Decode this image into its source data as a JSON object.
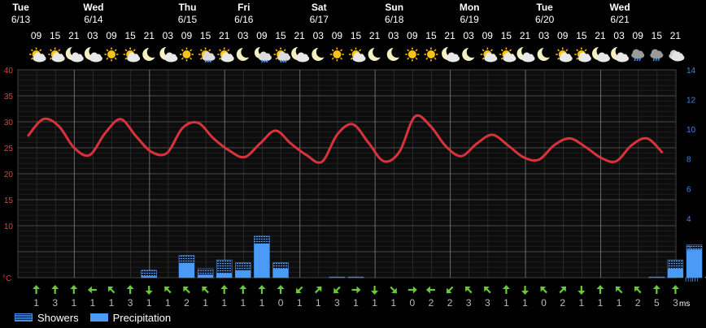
{
  "chart_data": {
    "type": "weather-forecast",
    "days": [
      {
        "name": "Tue",
        "date": "6/13"
      },
      {
        "name": "Wed",
        "date": "6/14"
      },
      {
        "name": "Thu",
        "date": "6/15"
      },
      {
        "name": "Fri",
        "date": "6/16"
      },
      {
        "name": "Sat",
        "date": "6/17"
      },
      {
        "name": "Sun",
        "date": "6/18"
      },
      {
        "name": "Mon",
        "date": "6/19"
      },
      {
        "name": "Tue",
        "date": "6/20"
      },
      {
        "name": "Wed",
        "date": "6/21"
      }
    ],
    "hours": [
      "09",
      "15",
      "21",
      "03",
      "09",
      "15",
      "21",
      "03",
      "09",
      "15",
      "21",
      "03",
      "09",
      "15",
      "21",
      "03",
      "09",
      "15",
      "21",
      "03",
      "09",
      "15",
      "21",
      "03",
      "09",
      "15",
      "21",
      "03",
      "09",
      "15",
      "21",
      "03",
      "09",
      "15",
      "21"
    ],
    "icons": [
      "sun-cloud",
      "sun-cloud",
      "moon-cloud",
      "moon-cloud",
      "sun",
      "sun-cloud",
      "moon",
      "moon-cloud",
      "sun",
      "sun-rain",
      "sun-cloud",
      "moon",
      "moon-rain",
      "sun-rain",
      "moon-cloud",
      "moon",
      "sun",
      "sun-cloud",
      "moon",
      "moon",
      "sun",
      "sun",
      "moon-cloud",
      "moon",
      "sun-cloud",
      "sun-cloud",
      "moon-cloud",
      "moon",
      "sun-cloud",
      "sun-cloud",
      "moon-cloud",
      "moon-cloud",
      "cloud-rain",
      "cloud-rain",
      "cloud"
    ],
    "temperature": [
      27.2,
      30.5,
      29.2,
      25.0,
      23.6,
      27.8,
      30.5,
      27.2,
      24.2,
      24.0,
      28.8,
      29.8,
      26.8,
      24.5,
      23.2,
      25.8,
      28.3,
      25.8,
      23.6,
      22.3,
      27.6,
      29.5,
      26.0,
      22.4,
      24.2,
      31.0,
      29.2,
      25.3,
      23.4,
      25.8,
      27.5,
      25.5,
      23.2,
      22.7,
      25.5,
      26.8,
      25.2,
      23.1,
      22.4,
      25.5,
      26.8,
      24.0
    ],
    "temp_axis": {
      "min": 0,
      "max": 40,
      "ticks": [
        10,
        15,
        20,
        25,
        30,
        35,
        40
      ],
      "unit": "°C"
    },
    "precip_axis": {
      "min": 0,
      "max": 14,
      "ticks": [
        2,
        4,
        6,
        8,
        10,
        12,
        14
      ],
      "unit": "mm"
    },
    "showers": [
      0,
      0,
      0,
      0,
      0,
      0,
      0.5,
      0,
      1.5,
      0.6,
      1.2,
      1.0,
      2.8,
      1.0,
      0,
      0,
      0.05,
      0.05,
      0,
      0,
      0,
      0,
      0,
      0,
      0,
      0,
      0,
      0,
      0,
      0,
      0,
      0,
      0,
      0.05,
      1.2,
      2.2,
      0.05
    ],
    "precipitation": [
      0,
      0,
      0,
      0,
      0,
      0,
      0.1,
      0,
      1.0,
      0.2,
      0.3,
      0.5,
      2.3,
      0.6,
      0,
      0,
      0.02,
      0.02,
      0,
      0,
      0,
      0,
      0,
      0,
      0,
      0,
      0,
      0,
      0,
      0,
      0,
      0,
      0,
      0.02,
      0.6,
      1.9,
      0.02
    ],
    "wind_direction_deg": [
      180,
      180,
      180,
      90,
      135,
      180,
      0,
      135,
      135,
      135,
      180,
      180,
      180,
      180,
      45,
      225,
      45,
      270,
      0,
      315,
      270,
      90,
      45,
      135,
      135,
      180,
      0,
      135,
      225,
      0,
      180,
      135,
      135,
      180,
      180,
      135
    ],
    "wind_speed": [
      "1",
      "3",
      "1",
      "1",
      "1",
      "3",
      "1",
      "1",
      "2",
      "1",
      "1",
      "1",
      "1",
      "0",
      "1",
      "1",
      "3",
      "1",
      "1",
      "1",
      "0",
      "2",
      "2",
      "3",
      "3",
      "1",
      "1",
      "0",
      "2",
      "1",
      "1",
      "1",
      "2",
      "5",
      "3"
    ],
    "wind_unit": "ms",
    "legend": {
      "showers": "Showers",
      "precipitation": "Precipitation"
    },
    "colors": {
      "temperature": "#d8333b",
      "precipitation": "#4b9af5",
      "showers": "#4b9af5",
      "wind": "#6ac83b",
      "temp_axis": "#e04040",
      "precip_axis": "#3c82e6",
      "grid": "#3a3a3a"
    }
  }
}
